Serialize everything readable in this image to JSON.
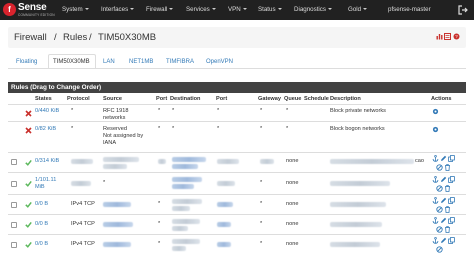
{
  "navbar": {
    "logo_text": "Sense",
    "logo_sub": "COMMUNITY EDITION",
    "menus": [
      "System",
      "Interfaces",
      "Firewall",
      "Services",
      "VPN",
      "Status",
      "Diagnostics",
      "Gold",
      "pfsense-master"
    ]
  },
  "breadcrumb": {
    "firewall": "Firewall",
    "sep1": "/",
    "rules": "Rules",
    "sep2": "/",
    "current": "TIM50X30MB"
  },
  "tabs": [
    "Floating",
    "TIM50X30MB",
    "LAN",
    "NET1MB",
    "TIMFIBRA",
    "OpenVPN"
  ],
  "table": {
    "heading": "Rules (Drag to Change Order)",
    "columns": [
      "States",
      "Protocol",
      "Source",
      "Port",
      "Destination",
      "Port",
      "Gateway",
      "Queue",
      "Schedule",
      "Description",
      "Actions"
    ],
    "rows": [
      {
        "states": "0/440 KiB",
        "protocol": "*",
        "source": "RFC 1918",
        "source2": "networks",
        "port": "*",
        "destination": "*",
        "dport": "*",
        "gateway": "*",
        "queue": "*",
        "schedule": "",
        "description": "Block private networks"
      },
      {
        "states": "0/82 KiB",
        "protocol": "*",
        "source": "Reserved",
        "source2": "Not assigned by",
        "source3": "IANA",
        "port": "*",
        "destination": "*",
        "dport": "*",
        "gateway": "*",
        "queue": "*",
        "schedule": "",
        "description": "Block bogon networks"
      },
      {
        "states": "0/314 KiB",
        "protocol": "",
        "source": "",
        "port": "",
        "destination": "",
        "dport": "",
        "gateway": "",
        "queue": "none",
        "schedule": "",
        "description": "",
        "desc_tail": "cao"
      },
      {
        "states": "1/101.11",
        "states2": "MiB",
        "protocol": "",
        "source": "*",
        "port": "",
        "destination": "",
        "dport": "",
        "gateway": "*",
        "queue": "none",
        "schedule": "",
        "description": ""
      },
      {
        "states": "0/0 B",
        "protocol": "IPv4 TCP",
        "source": "",
        "port": "*",
        "destination": "",
        "dport": "",
        "gateway": "*",
        "queue": "none",
        "schedule": "",
        "description": ""
      },
      {
        "states": "0/0 B",
        "protocol": "IPv4 TCP",
        "source": "",
        "port": "*",
        "destination": "",
        "dport": "",
        "gateway": "*",
        "queue": "none",
        "schedule": "",
        "description": ""
      },
      {
        "states": "0/0 B",
        "protocol": "IPv4 TCP",
        "source": "",
        "port": "*",
        "destination": "",
        "dport": "",
        "gateway": "*",
        "queue": "none",
        "schedule": "",
        "description": ""
      }
    ]
  },
  "colors": {
    "navbar": "#212121",
    "panel_heading": "#424242",
    "link": "#337ab7",
    "block": "#c9302c",
    "pass": "#5cb85c",
    "brand_red": "#d9232d"
  },
  "icons": {
    "block": "times-icon",
    "pass": "check-icon",
    "settings": "gear-icon",
    "edit": "pencil-icon",
    "copy": "copy-icon",
    "delete": "trash-icon",
    "anchor": "anchor-icon",
    "disable": "ban-icon"
  }
}
